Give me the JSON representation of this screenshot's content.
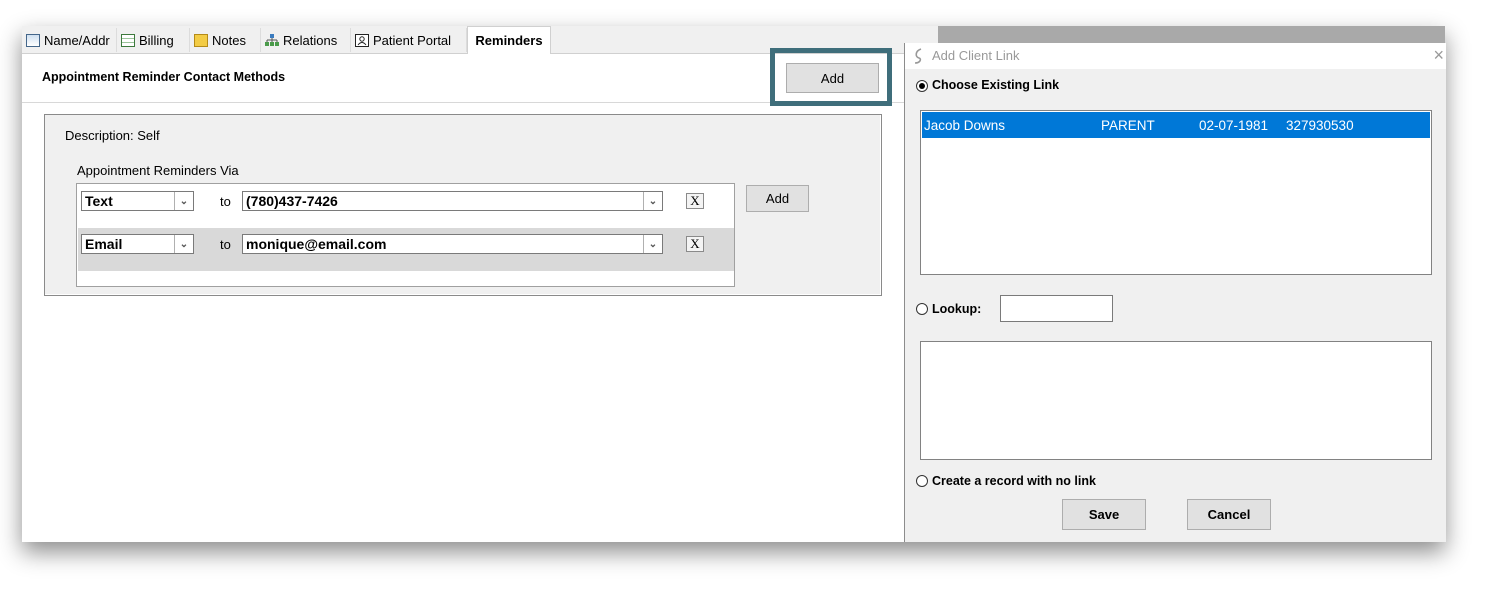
{
  "tabs": [
    {
      "label": "Name/Addr",
      "icon": "address-card-icon"
    },
    {
      "label": "Billing",
      "icon": "billing-calculator-icon"
    },
    {
      "label": "Notes",
      "icon": "notes-pencil-icon"
    },
    {
      "label": "Relations",
      "icon": "relations-tree-icon"
    },
    {
      "label": "Patient Portal",
      "icon": "portal-person-icon"
    },
    {
      "label": "Reminders",
      "icon": ""
    }
  ],
  "section": {
    "title": "Appointment Reminder Contact Methods",
    "add_label": "Add"
  },
  "group": {
    "description": "Description: Self",
    "via_label": "Appointment Reminders Via",
    "add_label": "Add",
    "rows": [
      {
        "method": "Text",
        "to": "to",
        "value": "(780)437-7426",
        "remove": "X"
      },
      {
        "method": "Email",
        "to": "to",
        "value": "monique@email.com",
        "remove": "X"
      }
    ]
  },
  "dialog": {
    "title": "Add Client Link",
    "close": "×",
    "choose_existing": "Choose Existing Link",
    "links": [
      {
        "name": "Jacob Downs",
        "relation": "PARENT",
        "dob": "02-07-1981",
        "id": "327930530"
      }
    ],
    "lookup_label": "Lookup:",
    "lookup_value": "",
    "no_link": "Create a record with no link",
    "save": "Save",
    "cancel": "Cancel"
  },
  "colors": {
    "highlight": "#3f6e7b",
    "selection": "#0078d7"
  }
}
